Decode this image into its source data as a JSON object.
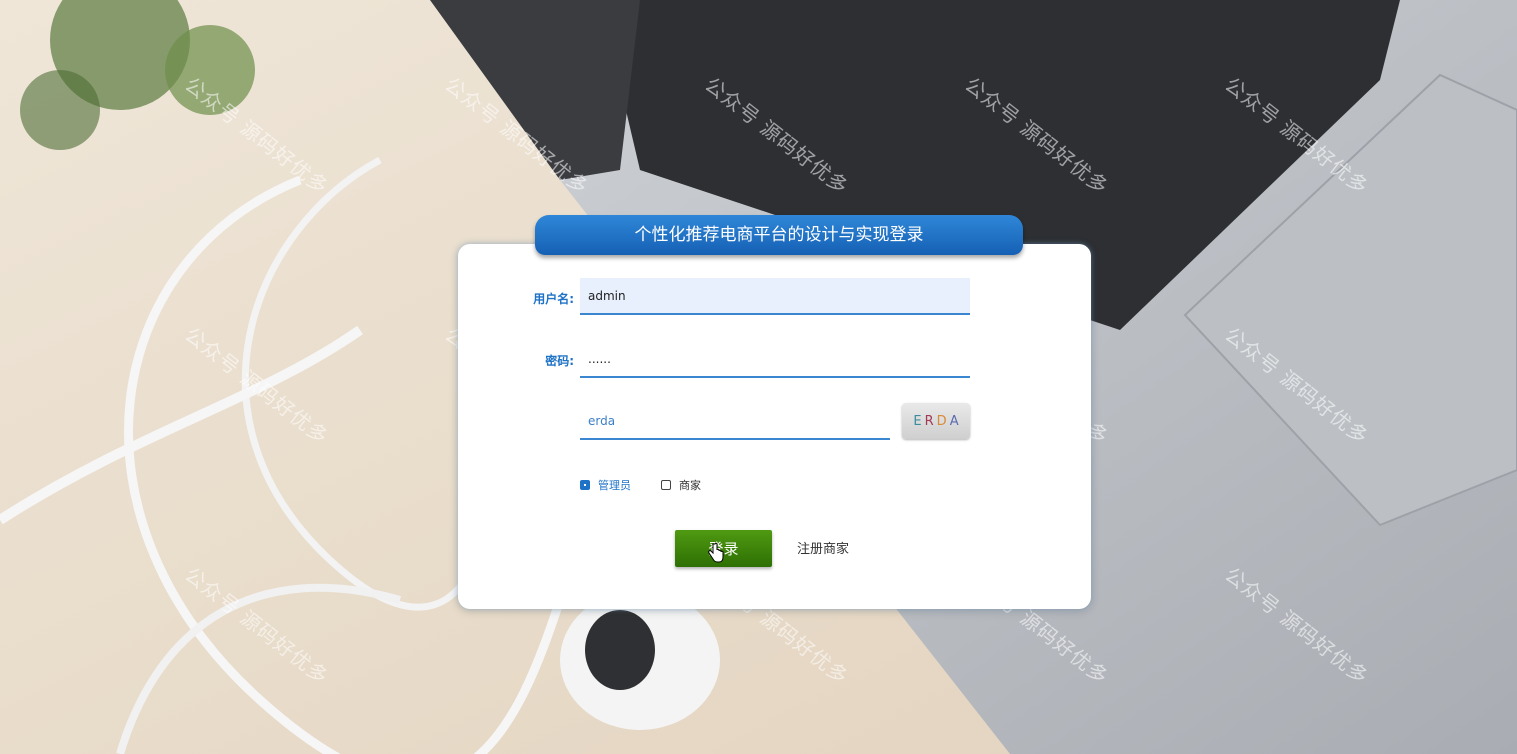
{
  "title": "个性化推荐电商平台的设计与实现登录",
  "form": {
    "username_label": "用户名:",
    "username_value": "admin",
    "password_label": "密码:",
    "password_value": "......",
    "captcha_value": "erda",
    "captcha_image_text": [
      "E",
      "R",
      "D",
      "A"
    ]
  },
  "roles": [
    {
      "label": "管理员",
      "checked": true
    },
    {
      "label": "商家",
      "checked": false
    }
  ],
  "actions": {
    "login_label": "登录",
    "register_label": "注册商家"
  },
  "watermark_text": "公众号 源码好优多",
  "colors": {
    "accent": "#1f73c7",
    "title_tab": "#1a6bc2",
    "login_button": "#3f8a0c"
  }
}
